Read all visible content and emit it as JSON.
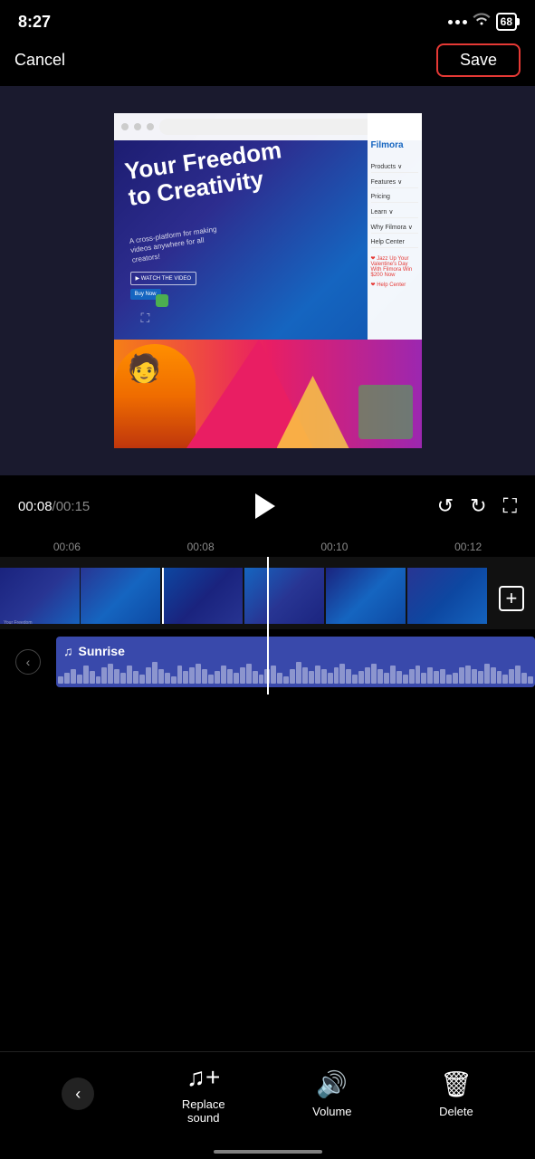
{
  "statusBar": {
    "time": "8:27",
    "battery": "68"
  },
  "nav": {
    "cancel": "Cancel",
    "save": "Save"
  },
  "controls": {
    "currentTime": "00:08",
    "totalTime": "00:15"
  },
  "timeline": {
    "marks": [
      "00:06",
      "00:08",
      "00:10",
      "00:12"
    ]
  },
  "audioTrack": {
    "name": "Sunrise",
    "musicNote": "♫"
  },
  "toolbar": {
    "replaceSound": "Replace\nsound",
    "volume": "Volume",
    "delete": "Delete",
    "backIcon": "‹"
  },
  "websiteContent": {
    "mainText": "Your Freedom\nto Creativity",
    "subText": "A cross-platform for making videos anywhere for all creators!",
    "sidebarItems": [
      "Filmora",
      "Products",
      "Features",
      "Pricing",
      "Learn",
      "Why Filmora",
      "Help Center"
    ]
  }
}
